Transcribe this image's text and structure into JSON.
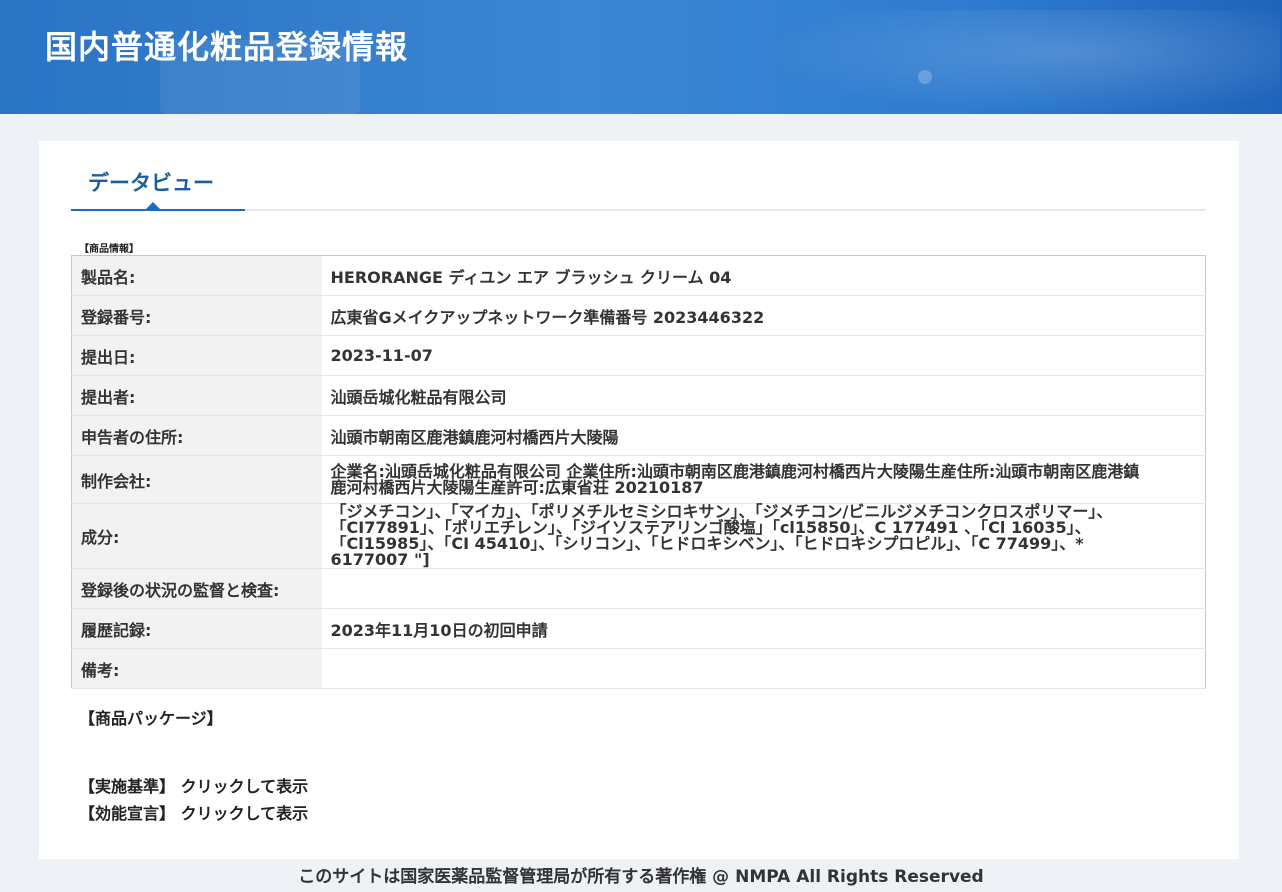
{
  "banner": {
    "title": "国内普通化粧品登録情報"
  },
  "tabs": [
    {
      "label": "データビュー"
    }
  ],
  "section_caption": "【商品情報】",
  "rows": [
    {
      "label": "製品名:",
      "value": "HERORANGE ディユン エア ブラッシュ クリーム 04"
    },
    {
      "label": "登録番号:",
      "value": "広東省Gメイクアップネットワーク準備番号 2023446322"
    },
    {
      "label": "提出日:",
      "value": "2023-11-07"
    },
    {
      "label": "提出者:",
      "value": "汕頭岳城化粧品有限公司"
    },
    {
      "label": "申告者の住所:",
      "value": "汕頭市朝南区鹿港鎮鹿河村橋西片大陵陽"
    },
    {
      "label": "制作会社:",
      "value": "企業名:汕頭岳城化粧品有限公司 企業住所:汕頭市朝南区鹿港鎮鹿河村橋西片大陵陽生産住所:汕頭市朝南区鹿港鎮鹿河村橋西片大陵陽生産許可:広東省荘 20210187"
    },
    {
      "label": "成分:",
      "value": "「ジメチコン」、「マイカ」、「ポリメチルセミシロキサン」、「ジメチコン/ビニルジメチコンクロスポリマー」、「CI77891」、「ポリエチレン」、「ジイソステアリンゴ酸塩」「cl15850」、C 177491 、「Cl 16035」、「Cl15985」、「CI 45410」、「シリコン」、「ヒドロキシベン」、「ヒドロキシプロピル」、「C 77499」、* 6177007 \"]"
    },
    {
      "label": "登録後の状況の監督と検査:",
      "value": ""
    },
    {
      "label": "履歴記録:",
      "value": "2023年11月10日の初回申請"
    },
    {
      "label": "備考:",
      "value": ""
    }
  ],
  "package_heading": "【商品パッケージ】",
  "standards": {
    "label": "【実施基準】",
    "link": "クリックして表示"
  },
  "claims": {
    "label": "【効能宣言】",
    "link": "クリックして表示"
  },
  "footer": {
    "text": "このサイトは国家医薬品監督管理局が所有する著作権 @ NMPA All Rights Reserved"
  },
  "colors": {
    "banner": "#2f7cd0",
    "tab_active": "#1b5f9e",
    "ingredient_label": "#b27322"
  }
}
